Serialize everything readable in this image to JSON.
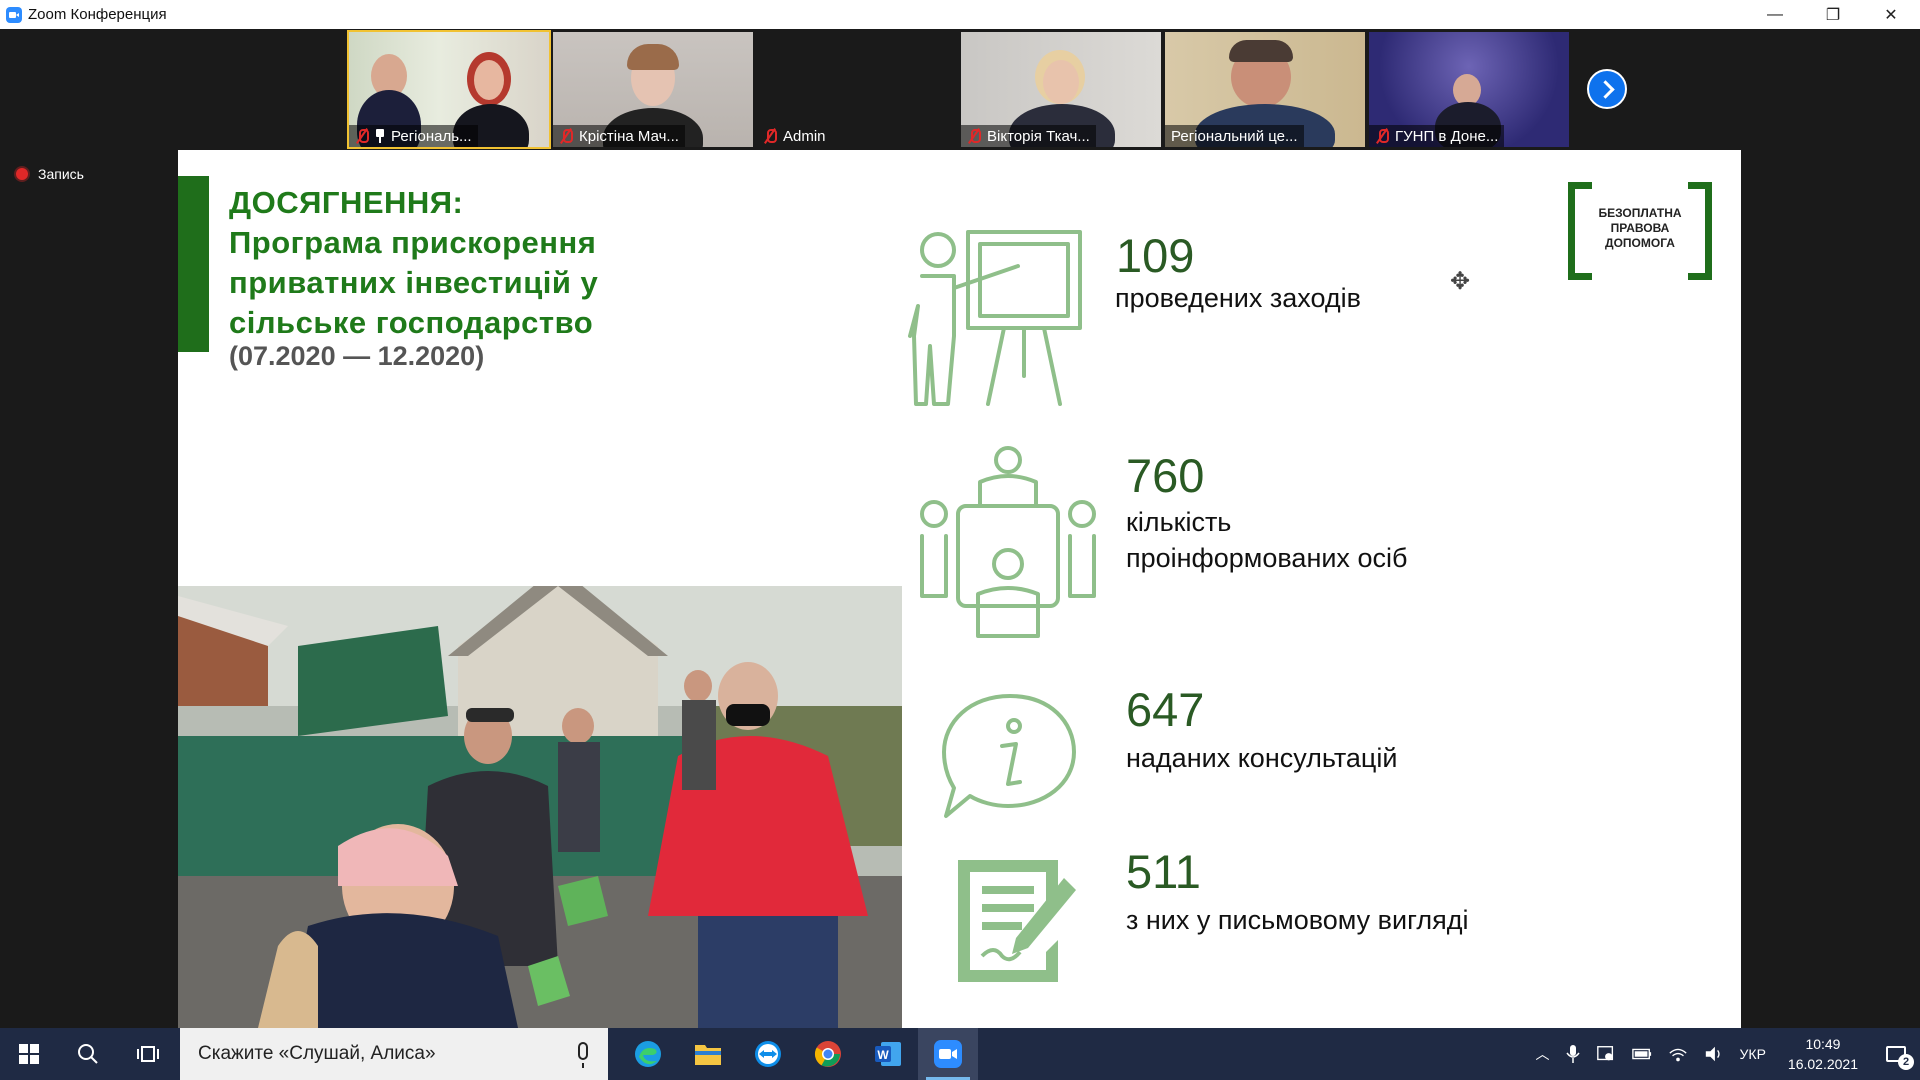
{
  "window": {
    "title": "Zoom Конференция",
    "controls": {
      "minimize": "—",
      "restore": "❐",
      "close": "✕"
    }
  },
  "participants": [
    {
      "name": "Регіональ...",
      "muted": true,
      "pinned": true,
      "active": true
    },
    {
      "name": "Крістіна Мач...",
      "muted": true
    },
    {
      "name": "Admin",
      "muted": true
    },
    {
      "name": "Вікторія Ткач...",
      "muted": true
    },
    {
      "name": "Регіональний це...",
      "muted": false
    },
    {
      "name": "ГУНП в Доне...",
      "muted": true
    }
  ],
  "recording": {
    "label": "Запись"
  },
  "slide": {
    "title_lines": [
      "ДОСЯГНЕННЯ:",
      "Програма прискорення",
      "приватних інвестицій у",
      "сільське господарство"
    ],
    "dates": "(07.2020 — 12.2020)",
    "logo_lines": [
      "БЕЗОПЛАТНА",
      "ПРАВОВА",
      "ДОПОМОГА"
    ],
    "stats": [
      {
        "number": "109",
        "label_lines": [
          "проведених заходів"
        ],
        "icon": "presentation-icon"
      },
      {
        "number": "760",
        "label_lines": [
          "кількість",
          "проінформованих осіб"
        ],
        "icon": "meeting-table-icon"
      },
      {
        "number": "647",
        "label_lines": [
          "наданих  консультацій"
        ],
        "icon": "info-bubble-icon"
      },
      {
        "number": "511",
        "label_lines": [
          "з них у письмовому вигляді"
        ],
        "icon": "document-pen-icon"
      }
    ]
  },
  "colors": {
    "accent_green": "#1f6e1b",
    "title_green": "#1f7a1a",
    "icon_green": "#8fbf8a",
    "zoom_blue": "#0e72ed",
    "taskbar": "#1f2a44"
  },
  "taskbar": {
    "search_placeholder": "Скажите «Слушай, Алиса»",
    "apps": [
      "edge-icon",
      "file-explorer-icon",
      "teamviewer-icon",
      "chrome-icon",
      "word-icon",
      "zoom-icon"
    ],
    "tray": {
      "language": "УКР",
      "time": "10:49",
      "date": "16.02.2021",
      "notifications": "2"
    }
  }
}
